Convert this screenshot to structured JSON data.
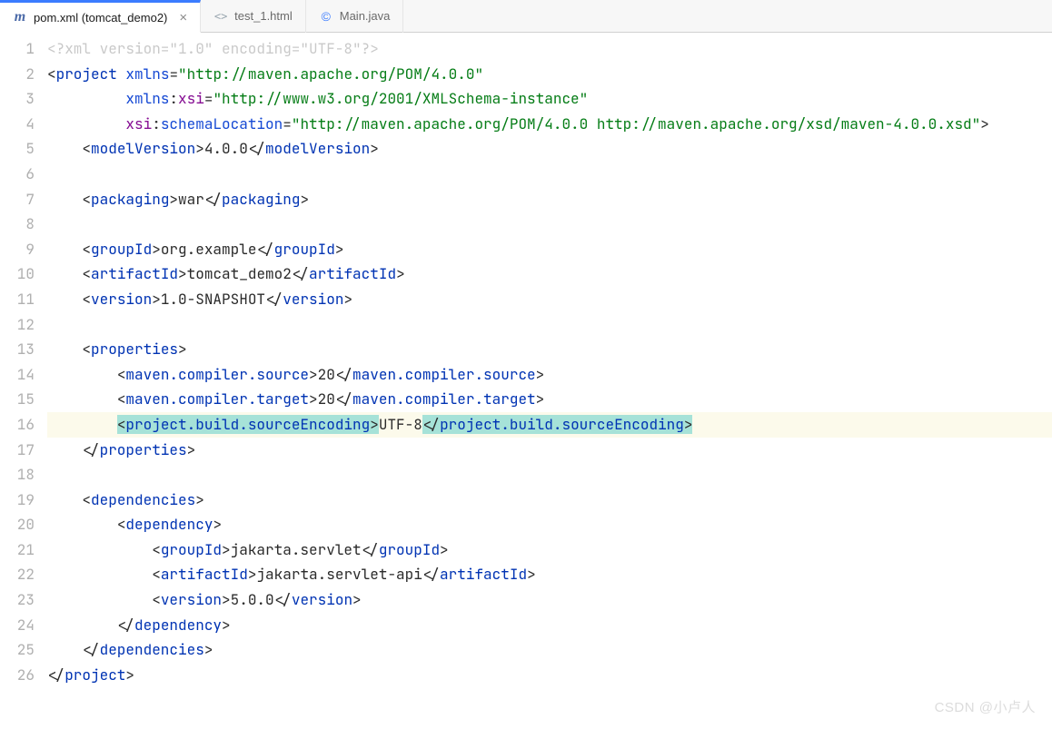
{
  "tabs": [
    {
      "label": "pom.xml (tomcat_demo2)",
      "iconColor": "#4b6aa8",
      "iconGlyph": "m",
      "active": true,
      "closable": true
    },
    {
      "label": "test_1.html",
      "iconColor": "#9aa7b0",
      "iconGlyph": "<>",
      "active": false,
      "closable": false
    },
    {
      "label": "Main.java",
      "iconColor": "#3b7cff",
      "iconGlyph": "©",
      "active": false,
      "closable": false
    }
  ],
  "totalLines": 26,
  "highlightLine": 16,
  "code": {
    "l1_raw": "<?xml version=\"1.0\" encoding=\"UTF-8\"?>",
    "l2_attr": "xmlns",
    "l2_val": "\"http://maven.apache.org/POM/4.0.0\"",
    "l3_ns": "xmlns",
    "l3_sfx": "xsi",
    "l3_val": "\"http://www.w3.org/2001/XMLSchema-instance\"",
    "l4_ns": "xsi",
    "l4_sfx": "schemaLocation",
    "l4_val": "\"http://maven.apache.org/POM/4.0.0 http://maven.apache.org/xsd/maven-4.0.0.xsd\"",
    "modelVersion": "4.0.0",
    "packaging": "war",
    "groupId": "org.example",
    "artifactId": "tomcat_demo2",
    "version": "1.0-SNAPSHOT",
    "compilerSource": "20",
    "compilerTarget": "20",
    "encoding": "UTF-8",
    "dep_groupId": "jakarta.servlet",
    "dep_artifactId": "jakarta.servlet-api",
    "dep_version": "5.0.0",
    "tag_project": "project",
    "tag_modelVersion": "modelVersion",
    "tag_packaging": "packaging",
    "tag_groupId": "groupId",
    "tag_artifactId": "artifactId",
    "tag_version": "version",
    "tag_properties": "properties",
    "tag_mcs": "maven.compiler.source",
    "tag_mct": "maven.compiler.target",
    "tag_pbse": "project.build.sourceEncoding",
    "tag_dependencies": "dependencies",
    "tag_dependency": "dependency"
  },
  "watermark": "CSDN @小卢人"
}
